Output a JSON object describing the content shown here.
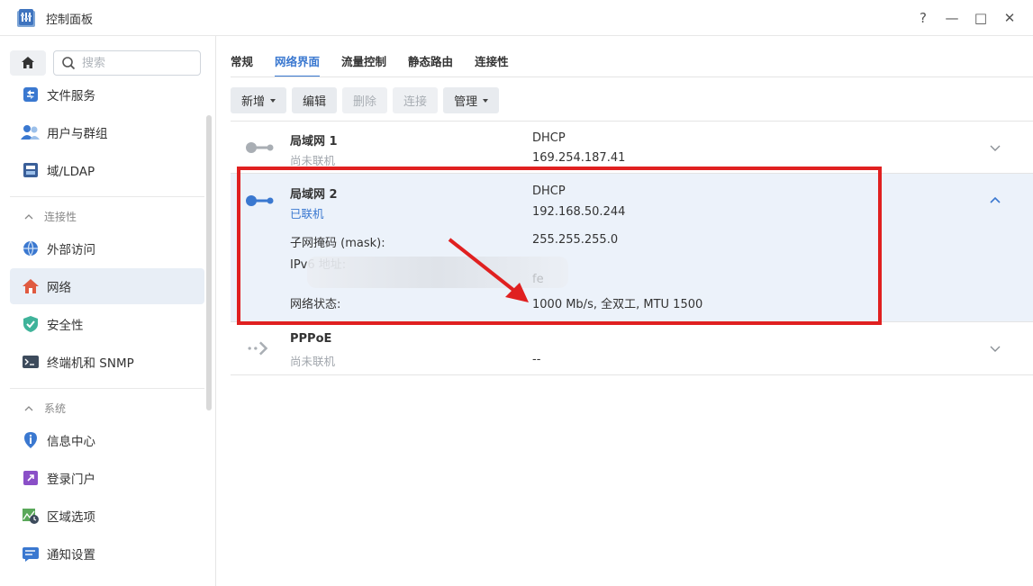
{
  "window": {
    "title": "控制面板",
    "controls": [
      "?",
      "—",
      "□",
      "✕"
    ]
  },
  "sidebar": {
    "search_placeholder": "搜索",
    "items_top": [
      {
        "label": "文件服务",
        "icon": "file-services-icon"
      },
      {
        "label": "用户与群组",
        "icon": "users-icon"
      },
      {
        "label": "域/LDAP",
        "icon": "domain-ldap-icon"
      }
    ],
    "section_connectivity": "连接性",
    "items_connectivity": [
      {
        "label": "外部访问",
        "icon": "globe-icon"
      },
      {
        "label": "网络",
        "icon": "network-home-icon",
        "active": true
      },
      {
        "label": "安全性",
        "icon": "shield-icon"
      },
      {
        "label": "终端机和 SNMP",
        "icon": "terminal-icon"
      }
    ],
    "section_system": "系统",
    "items_system": [
      {
        "label": "信息中心",
        "icon": "info-icon"
      },
      {
        "label": "登录门户",
        "icon": "login-portal-icon"
      },
      {
        "label": "区域选项",
        "icon": "region-icon"
      },
      {
        "label": "通知设置",
        "icon": "notification-icon"
      }
    ]
  },
  "tabs": [
    {
      "label": "常规"
    },
    {
      "label": "网络界面",
      "active": true
    },
    {
      "label": "流量控制"
    },
    {
      "label": "静态路由"
    },
    {
      "label": "连接性"
    }
  ],
  "toolbar": {
    "add": "新增",
    "edit": "编辑",
    "delete": "删除",
    "connect": "连接",
    "manage": "管理"
  },
  "interfaces": [
    {
      "name": "局域网 1",
      "status": "尚未联机",
      "mode": "DHCP",
      "ip": "169.254.187.41"
    },
    {
      "name": "局域网 2",
      "status": "已联机",
      "mode": "DHCP",
      "ip": "192.168.50.244",
      "details": {
        "mask_label": "子网掩码 (mask):",
        "mask_value": "255.255.255.0",
        "ipv6_label": "IPv6 地址:",
        "ipv6_value": "fe",
        "netstate_label": "网络状态:",
        "netstate_value": "1000 Mb/s, 全双工, MTU 1500"
      }
    },
    {
      "name": "PPPoE",
      "status": "尚未联机",
      "value": "--"
    }
  ],
  "colors": {
    "accent": "#3a78d0",
    "highlight": "#e02020"
  }
}
